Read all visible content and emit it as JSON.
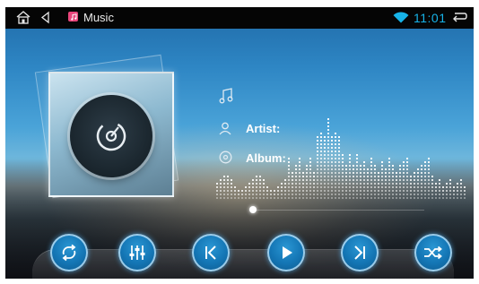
{
  "status_bar": {
    "app_name": "Music",
    "time": "11:01",
    "icons": [
      "home-icon",
      "back-icon",
      "music-app-icon",
      "wifi-icon",
      "return-icon"
    ]
  },
  "track_info": {
    "artist_label": "Artist:",
    "album_label": "Album:",
    "icons": [
      "music-note-icon",
      "person-icon",
      "disc-icon"
    ]
  },
  "playback": {
    "progress": 0.0
  },
  "controls": [
    {
      "name": "repeat-button",
      "icon": "repeat-icon"
    },
    {
      "name": "equalizer-button",
      "icon": "equalizer-icon"
    },
    {
      "name": "previous-button",
      "icon": "previous-icon"
    },
    {
      "name": "play-button",
      "icon": "play-icon"
    },
    {
      "name": "next-button",
      "icon": "next-icon"
    },
    {
      "name": "shuffle-button",
      "icon": "shuffle-icon"
    }
  ],
  "colors": {
    "accent": "#17b3e8",
    "button": "#1476b5",
    "app_icon": "#e9457b"
  }
}
